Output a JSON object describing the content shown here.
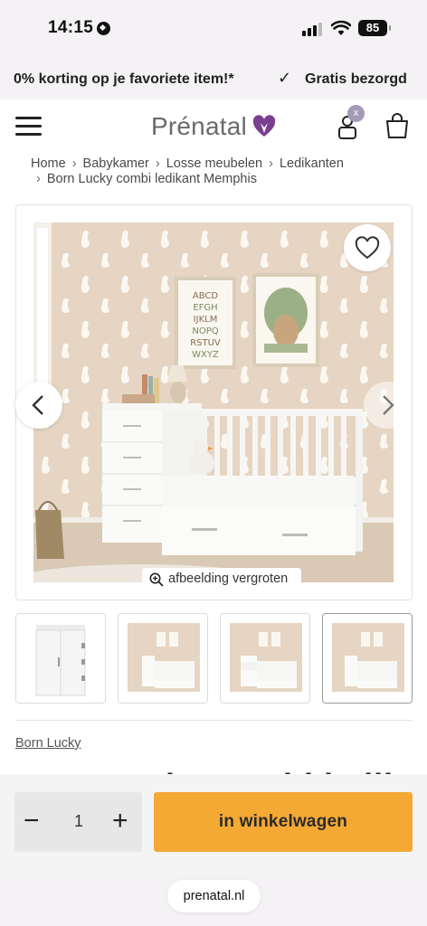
{
  "status_bar": {
    "time": "14:15",
    "battery": "85"
  },
  "promo": {
    "text_left": "0% korting op je favoriete item!*",
    "text_right": "Gratis bezorgd"
  },
  "header": {
    "logo_text": "Prénatal",
    "badge": "x"
  },
  "breadcrumb": {
    "items": [
      "Home",
      "Babykamer",
      "Losse meubelen",
      "Ledikanten"
    ],
    "current": "Born Lucky combi ledikant Memphis"
  },
  "gallery": {
    "zoom_label": "afbeelding vergroten",
    "poster_letters": [
      "ABCD",
      "EFGH",
      "IJKLM",
      "NOPQ",
      "RSTUV",
      "WXYZ"
    ],
    "thumbnails": 4,
    "active_thumbnail": 4
  },
  "product": {
    "brand": "Born Lucky",
    "title_peek": "Born Lucky combi ledikant"
  },
  "purchase": {
    "qty_minus": "−",
    "quantity": "1",
    "qty_plus": "+",
    "add_to_cart": "in winkelwagen"
  },
  "browser": {
    "url": "prenatal.nl"
  },
  "colors": {
    "accent": "#f4a935",
    "heart": "#7b3f8f",
    "background": "#f4f2f4",
    "wall": "#e8d8c6"
  }
}
